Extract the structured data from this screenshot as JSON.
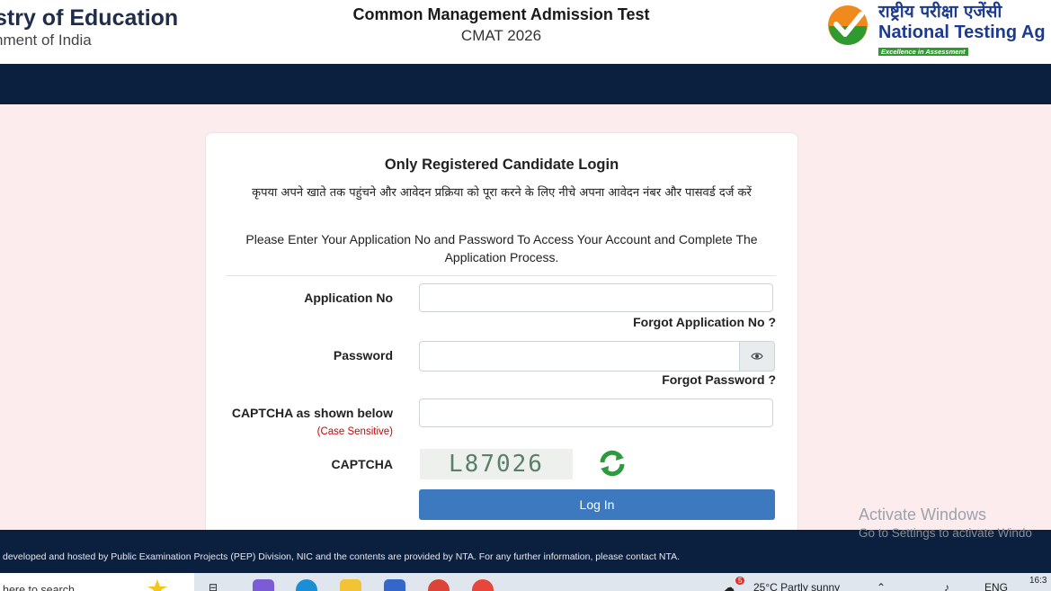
{
  "header": {
    "ministry_title": "stry of Education",
    "ministry_subtitle": "nment of India",
    "exam_name": "Common Management Admission Test",
    "exam_code": "CMAT 2026",
    "agency_hindi": "राष्ट्रीय परीक्षा एजेंसी",
    "agency_english": "National Testing Ag",
    "agency_tagline": "Excellence in Assessment"
  },
  "login": {
    "title": "Only Registered Candidate Login",
    "instruction_hindi": "कृपया अपने खाते तक पहुंचने और आवेदन प्रक्रिया को पूरा करने के लिए नीचे अपना आवेदन नंबर और पासवर्ड दर्ज करें",
    "instruction_english": "Please Enter Your Application No and Password To Access Your Account and Complete The Application Process.",
    "application_label": "Application No",
    "application_value": "",
    "forgot_application": "Forgot Application No ?",
    "password_label": "Password",
    "password_value": "",
    "forgot_password": "Forgot Password ?",
    "captcha_input_label": "CAPTCHA as shown below",
    "case_sensitive": "(Case Sensitive)",
    "captcha_input_value": "",
    "captcha_label": "CAPTCHA",
    "captcha_text": "L87026",
    "login_button": "Log In"
  },
  "footer": {
    "text": "developed and hosted by Public Examination Projects (PEP) Division, NIC and the contents are provided by NTA. For any further information, please contact NTA."
  },
  "watermark": {
    "line1": "Activate Windows",
    "line2": "Go to Settings to activate Windo"
  },
  "taskbar": {
    "search_text": "here to search",
    "weather": "25°C  Partly sunny",
    "notification_count": "5",
    "language": "ENG",
    "time": "16:3"
  },
  "colors": {
    "page_bg": "#fdeced",
    "navbar": "#0b1f3f",
    "login_button": "#3c79be",
    "case_sensitive": "#d00000",
    "brand_blue": "#1c3b8f",
    "brand_green": "#2f9a2f"
  }
}
